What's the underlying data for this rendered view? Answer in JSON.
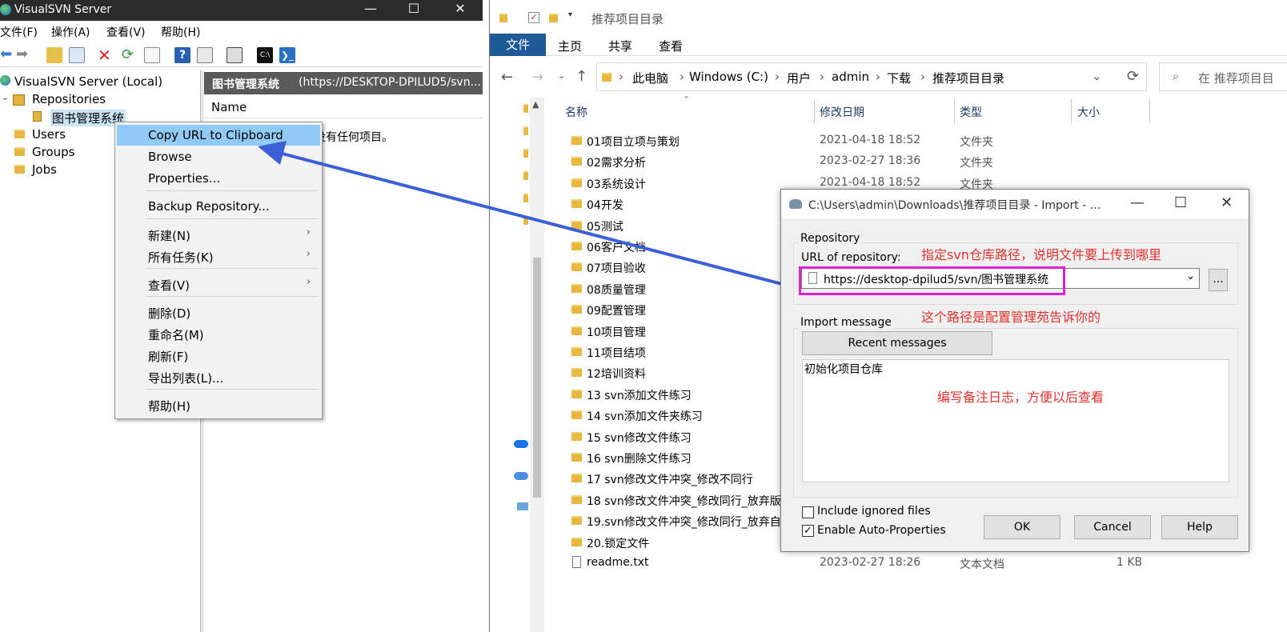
{
  "visualsvn": {
    "title": "VisualSVN Server",
    "menu": [
      "文件(F)",
      "操作(A)",
      "查看(V)",
      "帮助(H)"
    ],
    "tree": {
      "root": "VisualSVN Server (Local)",
      "repositories": "Repositories",
      "repo_item": "图书管理系统",
      "users": "Users",
      "groups": "Groups",
      "jobs": "Jobs"
    },
    "right_panel": {
      "header_title": "图书管理系统",
      "header_url": "(https://DESKTOP-DPILUD5/svn...",
      "name_col": "Name",
      "empty_text": "没有任何项目。"
    }
  },
  "context_menu": {
    "items": [
      {
        "label": "Copy URL to Clipboard"
      },
      {
        "label": "Browse"
      },
      {
        "label": "Properties..."
      },
      {
        "label": "Backup Repository..."
      },
      {
        "label": "新建(N)",
        "arrow": "›"
      },
      {
        "label": "所有任务(K)",
        "arrow": "›"
      },
      {
        "label": "查看(V)",
        "arrow": "›"
      },
      {
        "label": "删除(D)"
      },
      {
        "label": "重命名(M)"
      },
      {
        "label": "刷新(F)"
      },
      {
        "label": "导出列表(L)..."
      },
      {
        "label": "帮助(H)"
      }
    ]
  },
  "explorer": {
    "title": "推荐项目目录",
    "ribbon_tabs": [
      "文件",
      "主页",
      "共享",
      "查看"
    ],
    "breadcrumb": [
      "此电脑",
      "Windows (C:)",
      "用户",
      "admin",
      "下载",
      "推荐项目目录"
    ],
    "search_placeholder": "在 推荐项目目",
    "columns": {
      "name": "名称",
      "date": "修改日期",
      "type": "类型",
      "size": "大小"
    },
    "rows": [
      {
        "name": "01项目立项与策划",
        "date": "2021-04-18 18:52",
        "type": "文件夹",
        "size": ""
      },
      {
        "name": "02需求分析",
        "date": "2023-02-27 18:36",
        "type": "文件夹",
        "size": ""
      },
      {
        "name": "03系统设计",
        "date": "2021-04-18 18:52",
        "type": "文件夹",
        "size": ""
      },
      {
        "name": "04开发",
        "date": "",
        "type": "",
        "size": ""
      },
      {
        "name": "05测试",
        "date": "",
        "type": "",
        "size": ""
      },
      {
        "name": "06客户文档",
        "date": "",
        "type": "",
        "size": ""
      },
      {
        "name": "07项目验收",
        "date": "",
        "type": "",
        "size": ""
      },
      {
        "name": "08质量管理",
        "date": "",
        "type": "",
        "size": ""
      },
      {
        "name": "09配置管理",
        "date": "",
        "type": "",
        "size": ""
      },
      {
        "name": "10项目管理",
        "date": "",
        "type": "",
        "size": ""
      },
      {
        "name": "11项目结项",
        "date": "",
        "type": "",
        "size": ""
      },
      {
        "name": "12培训资料",
        "date": "",
        "type": "",
        "size": ""
      },
      {
        "name": "13 svn添加文件练习",
        "date": "",
        "type": "",
        "size": ""
      },
      {
        "name": "14 svn添加文件夹练习",
        "date": "",
        "type": "",
        "size": ""
      },
      {
        "name": "15 svn修改文件练习",
        "date": "",
        "type": "",
        "size": ""
      },
      {
        "name": "16 svn删除文件练习",
        "date": "",
        "type": "",
        "size": ""
      },
      {
        "name": "17 svn修改文件冲突_修改不同行",
        "date": "",
        "type": "",
        "size": ""
      },
      {
        "name": "18 svn修改文件冲突_修改同行_放弃版",
        "date": "",
        "type": "",
        "size": ""
      },
      {
        "name": "19.svn修改文件冲突_修改同行_放弃自",
        "date": "",
        "type": "",
        "size": ""
      },
      {
        "name": "20.锁定文件",
        "date": "",
        "type": "",
        "size": ""
      },
      {
        "name": "readme.txt",
        "date": "2023-02-27 18:26",
        "type": "文本文档",
        "size": "1 KB"
      }
    ]
  },
  "dialog": {
    "title": "C:\\Users\\admin\\Downloads\\推荐项目目录 - Import - ...",
    "repository_group": "Repository",
    "url_label": "URL of repository:",
    "url_value": "https://desktop-dpilud5/svn/图书管理系统",
    "browse_button": "...",
    "import_group": "Import message",
    "recent_button": "Recent messages",
    "message_text": "初始化项目仓库",
    "include_ignored": "Include ignored files",
    "auto_props": "Enable Auto-Properties",
    "ok": "OK",
    "cancel": "Cancel",
    "help": "Help"
  },
  "annotations": {
    "note1": "指定svn仓库路径，说明文件要上传到哪里",
    "note2": "这个路径是配置管理苑告诉你的",
    "note3": "编写备注日志，方便以后查看"
  },
  "colors": {
    "annotation_red": "#e0312f",
    "highlight_magenta": "#e020d8",
    "arrow_blue": "#3a5fd6",
    "menu_highlight": "#91c9f7",
    "ribbon_blue": "#1e5a99"
  }
}
